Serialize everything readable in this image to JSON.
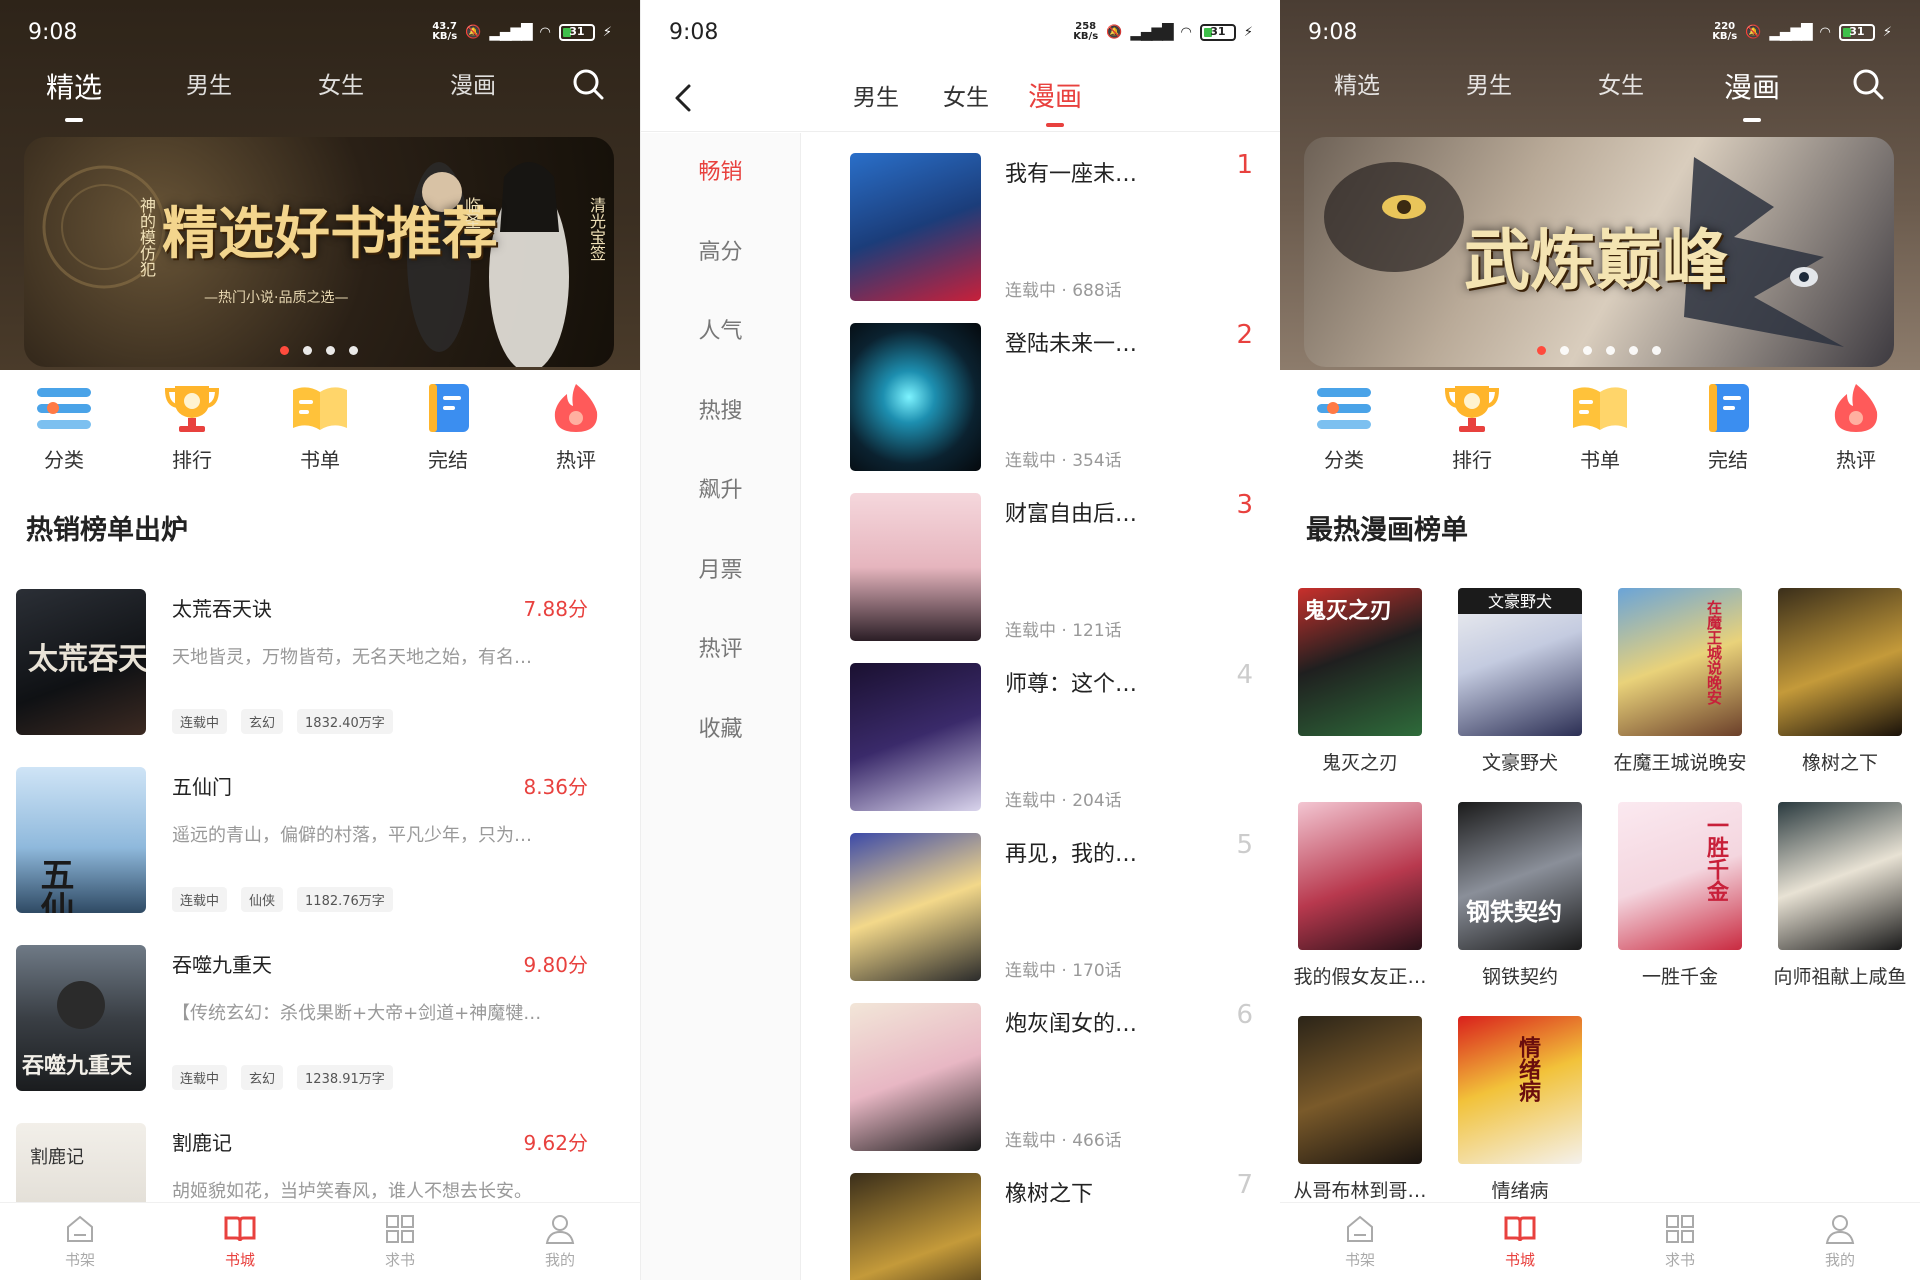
{
  "status_left": {
    "time": "9:08",
    "speed": "43.7",
    "speed_unit": "KB/s",
    "battery": "31"
  },
  "status_mid": {
    "time": "9:08",
    "speed": "258",
    "speed_unit": "KB/s",
    "battery": "31"
  },
  "status_right": {
    "time": "9:08",
    "speed": "220",
    "speed_unit": "KB/s",
    "battery": "31"
  },
  "top_tabs": [
    "精选",
    "男生",
    "女生",
    "漫画"
  ],
  "quick_links": [
    "分类",
    "排行",
    "书单",
    "完结",
    "热评"
  ],
  "panel_home": {
    "banner": {
      "title": "精选好书推荐",
      "subtitle": "—热门小说·品质之选—",
      "side_left": "神的模仿犯",
      "side_mid": "临圣",
      "side_right": "清光宝签"
    },
    "section_title": "热销榜单出炉",
    "books": [
      {
        "title": "太荒吞天诀",
        "score": "7.88分",
        "desc": "天地皆灵，万物皆苟，无名天地之始，有名…",
        "tags": [
          "连载中",
          "玄幻",
          "1832.40万字"
        ],
        "cover_text": "太荒吞天诀"
      },
      {
        "title": "五仙门",
        "score": "8.36分",
        "desc": "遥远的青山，偏僻的村落，平凡少年，只为…",
        "tags": [
          "连载中",
          "仙侠",
          "1182.76万字"
        ],
        "cover_text": "五仙门"
      },
      {
        "title": "吞噬九重天",
        "score": "9.80分",
        "desc": "【传统玄幻：杀伐果断+大帝+剑道+神魔犍…",
        "tags": [
          "连载中",
          "玄幻",
          "1238.91万字"
        ],
        "cover_text": "吞噬九重天"
      },
      {
        "title": "割鹿记",
        "score": "9.62分",
        "desc": "胡姬貌如花，当垆笑春风，谁人不想去长安。",
        "tags": [],
        "cover_text": "割鹿记"
      }
    ]
  },
  "panel_rank": {
    "tabs": [
      "男生",
      "女生",
      "漫画"
    ],
    "sidebar": [
      "畅销",
      "高分",
      "人气",
      "热搜",
      "飙升",
      "月票",
      "热评",
      "收藏"
    ],
    "items": [
      {
        "rank": "1",
        "title": "我有一座末…",
        "meta": "连载中 · 688话"
      },
      {
        "rank": "2",
        "title": "登陆未来一…",
        "meta": "连载中 · 354话"
      },
      {
        "rank": "3",
        "title": "财富自由后…",
        "meta": "连载中 · 121话"
      },
      {
        "rank": "4",
        "title": "师尊：这个…",
        "meta": "连载中 · 204话"
      },
      {
        "rank": "5",
        "title": "再见，我的…",
        "meta": "连载中 · 170话"
      },
      {
        "rank": "6",
        "title": "炮灰闺女的…",
        "meta": "连载中 · 466话"
      },
      {
        "rank": "7",
        "title": "橡树之下",
        "meta": ""
      }
    ]
  },
  "panel_comic": {
    "banner": {
      "title": "武炼巅峰"
    },
    "section_title": "最热漫画榜单",
    "comics": [
      {
        "name": "鬼灭之刃",
        "cover_text": "鬼灭之刃"
      },
      {
        "name": "文豪野犬",
        "cover_text": "文豪野犬"
      },
      {
        "name": "在魔王城说晚安",
        "cover_text": "在魔王城说晚安"
      },
      {
        "name": "橡树之下",
        "cover_text": ""
      },
      {
        "name": "我的假女友正…",
        "cover_text": ""
      },
      {
        "name": "钢铁契约",
        "cover_text": "钢铁契约"
      },
      {
        "name": "一胜千金",
        "cover_text": "一胜千金"
      },
      {
        "name": "向师祖献上咸鱼",
        "cover_text": ""
      },
      {
        "name": "从哥布林到哥…",
        "cover_text": ""
      },
      {
        "name": "情绪病",
        "cover_text": "情绪病"
      }
    ]
  },
  "bottom_nav": [
    "书架",
    "书城",
    "求书",
    "我的"
  ],
  "colors": {
    "accent": "#e8413e",
    "muted": "#999999",
    "dark_header": "#3a2e22"
  }
}
